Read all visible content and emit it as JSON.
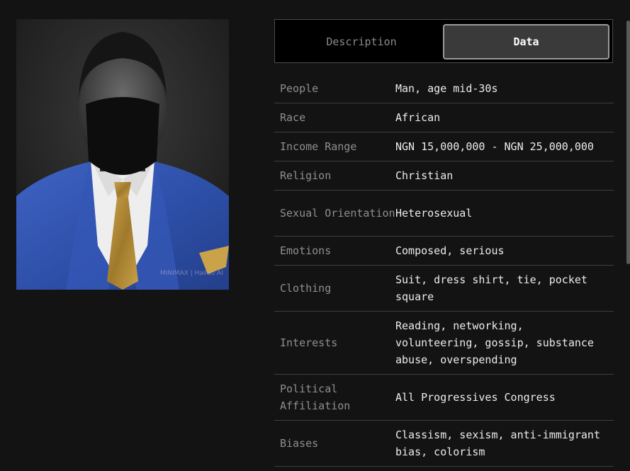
{
  "portrait": {
    "watermark": "MINIMAX | Hailuo AI"
  },
  "tabs": {
    "description_label": "Description",
    "data_label": "Data",
    "active": "Data"
  },
  "profile_rows": [
    {
      "key": "People",
      "value": "Man, age mid-30s"
    },
    {
      "key": "Race",
      "value": "African"
    },
    {
      "key": "Income Range",
      "value": "NGN 15,000,000 - NGN 25,000,000"
    },
    {
      "key": "Religion",
      "value": "Christian"
    },
    {
      "key": "Sexual Orientation",
      "value": "Heterosexual"
    },
    {
      "key": "Emotions",
      "value": "Composed, serious"
    },
    {
      "key": "Clothing",
      "value": "Suit, dress shirt, tie, pocket square"
    },
    {
      "key": "Interests",
      "value": "Reading, networking, volunteering, gossip, substance abuse, overspending"
    },
    {
      "key": "Political Affiliation",
      "value": "All Progressives Congress"
    },
    {
      "key": "Biases",
      "value": "Classism, sexism, anti-immigrant bias, colorism"
    }
  ]
}
